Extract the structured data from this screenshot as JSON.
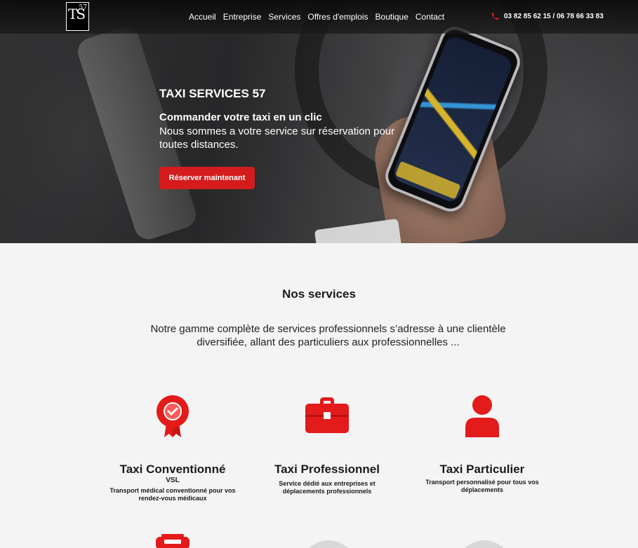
{
  "header": {
    "logo": {
      "big": "TS",
      "small": "57"
    },
    "nav": [
      "Accueil",
      "Entreprise",
      "Services",
      "Offres d'emplois",
      "Boutique",
      "Contact"
    ],
    "phone": "03 82 85 62 15 / 06 78 66 33 83",
    "phone_icon": "phone-icon"
  },
  "hero": {
    "title": "TAXI SERVICES 57",
    "subtitle": "Commander votre taxi en un clic",
    "description": "Nous sommes a votre service sur réservation pour toutes distances.",
    "cta": "Réserver maintenant"
  },
  "services": {
    "title": "Nos services",
    "intro": "Notre gamme complète de services professionnels s’adresse à une clientèle diversifiée, allant des particuliers aux professionnelles ...",
    "cards": [
      {
        "icon": "badge-check-icon",
        "name": "Taxi Conventionné",
        "tag": "VSL",
        "desc": "Transport médical conventionné pour vos rendez-vous médicaux"
      },
      {
        "icon": "briefcase-icon",
        "name": "Taxi Professionnel",
        "tag": "",
        "desc": "Service dédié aux entreprises et déplacements professionnels"
      },
      {
        "icon": "user-icon",
        "name": "Taxi Particulier",
        "tag": "",
        "desc": "Transport personnalisé pour tous vos déplacements"
      }
    ]
  },
  "colors": {
    "accent": "#d41c1c",
    "header_bg": "#141414",
    "page_bg": "#f4f4f4"
  }
}
